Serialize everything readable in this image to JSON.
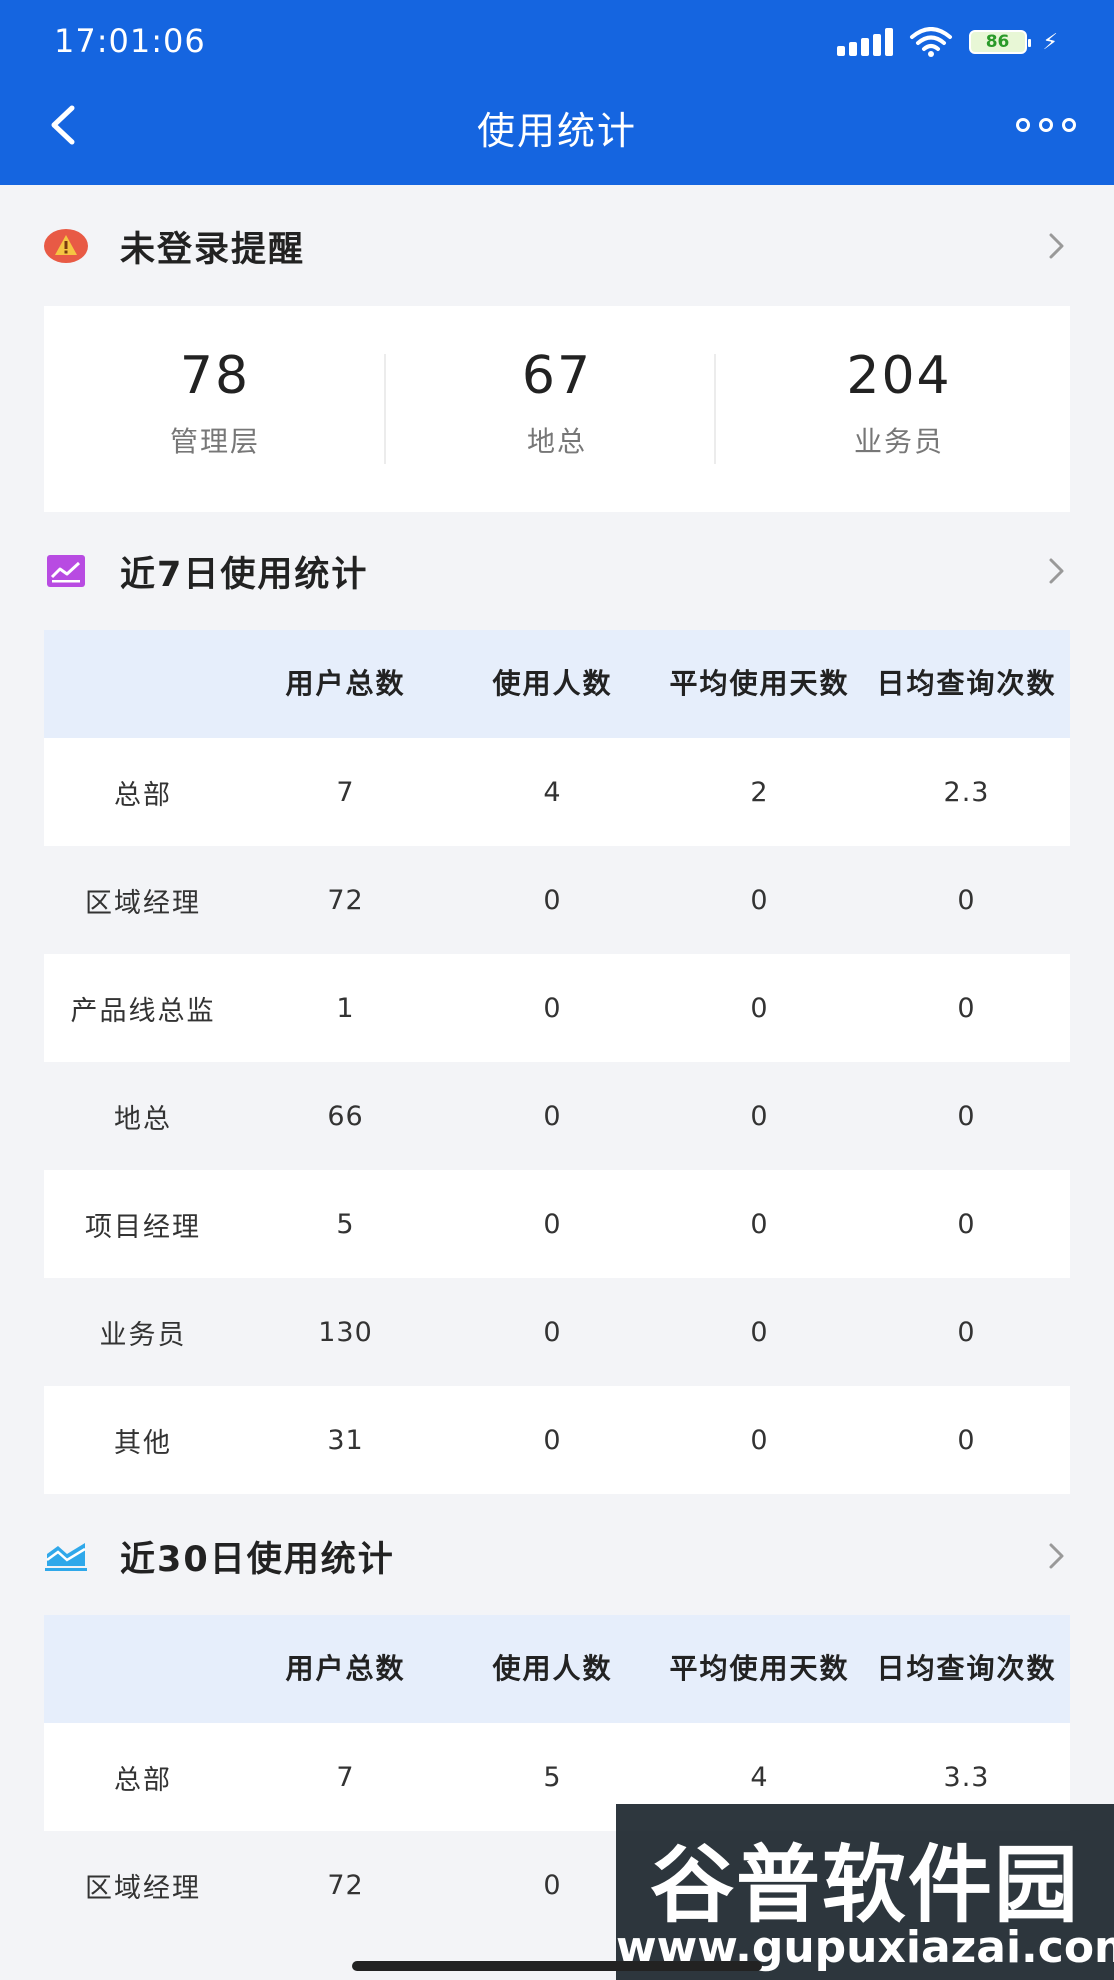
{
  "status_bar": {
    "time": "17:01:06",
    "battery": "86"
  },
  "nav": {
    "title": "使用统计"
  },
  "reminder": {
    "title": "未登录提醒",
    "stats": [
      {
        "value": "78",
        "label": "管理层"
      },
      {
        "value": "67",
        "label": "地总"
      },
      {
        "value": "204",
        "label": "业务员"
      }
    ]
  },
  "week": {
    "title": "近7日使用统计",
    "headers": [
      "",
      "用户总数",
      "使用人数",
      "平均使用天数",
      "日均查询次数"
    ],
    "rows": [
      [
        "总部",
        "7",
        "4",
        "2",
        "2.3"
      ],
      [
        "区域经理",
        "72",
        "0",
        "0",
        "0"
      ],
      [
        "产品线总监",
        "1",
        "0",
        "0",
        "0"
      ],
      [
        "地总",
        "66",
        "0",
        "0",
        "0"
      ],
      [
        "项目经理",
        "5",
        "0",
        "0",
        "0"
      ],
      [
        "业务员",
        "130",
        "0",
        "0",
        "0"
      ],
      [
        "其他",
        "31",
        "0",
        "0",
        "0"
      ]
    ]
  },
  "month": {
    "title": "近30日使用统计",
    "headers": [
      "",
      "用户总数",
      "使用人数",
      "平均使用天数",
      "日均查询次数"
    ],
    "rows": [
      [
        "总部",
        "7",
        "5",
        "4",
        "3.3"
      ],
      [
        "区域经理",
        "72",
        "0",
        "",
        ""
      ]
    ]
  },
  "watermark": {
    "logo": "谷普软件园",
    "url": "www.gupuxiazai.com"
  },
  "colors": {
    "primary": "#1565e0",
    "table_header": "#e6eefb",
    "warning": "#e85a45",
    "chart_icon": "#b84be2",
    "chart_icon2": "#2fa8ea"
  }
}
